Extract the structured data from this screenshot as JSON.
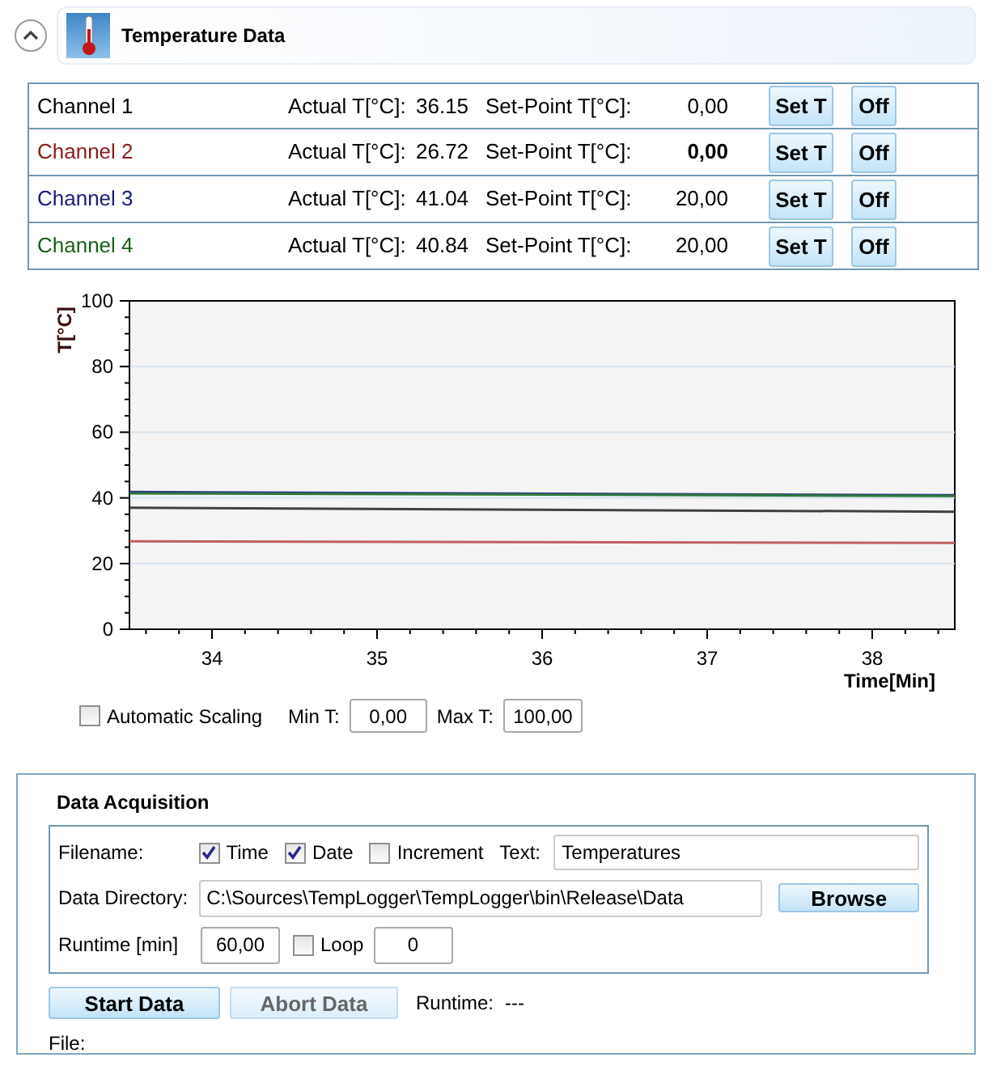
{
  "header": {
    "title": "Temperature Data",
    "expanded": true
  },
  "channels": [
    {
      "name": "Channel 1",
      "color": "#000000",
      "actual_label": "Actual T[°C]:",
      "actual": "36.15",
      "setpoint_label": "Set-Point T[°C]:",
      "setpoint": "0,00",
      "setpoint_bold": false,
      "set_button": "Set T",
      "off_button": "Off"
    },
    {
      "name": "Channel 2",
      "color": "#8b1a1a",
      "actual_label": "Actual T[°C]:",
      "actual": "26.72",
      "setpoint_label": "Set-Point T[°C]:",
      "setpoint": "0,00",
      "setpoint_bold": true,
      "set_button": "Set T",
      "off_button": "Off"
    },
    {
      "name": "Channel 3",
      "color": "#1a1a80",
      "actual_label": "Actual T[°C]:",
      "actual": "41.04",
      "setpoint_label": "Set-Point T[°C]:",
      "setpoint": "20,00",
      "setpoint_bold": false,
      "set_button": "Set T",
      "off_button": "Off"
    },
    {
      "name": "Channel 4",
      "color": "#1a5e1a",
      "actual_label": "Actual T[°C]:",
      "actual": "40.84",
      "setpoint_label": "Set-Point T[°C]:",
      "setpoint": "20,00",
      "setpoint_bold": false,
      "set_button": "Set T",
      "off_button": "Off"
    }
  ],
  "chart": {
    "chart_data": {
      "type": "line",
      "grid": true,
      "xlabel": "Time[Min]",
      "ylabel": "T[°C]",
      "x": [
        33.5,
        38.5
      ],
      "xlim": [
        33.5,
        38.5
      ],
      "ylim": [
        0,
        100
      ],
      "xticks": [
        34,
        35,
        36,
        37,
        38
      ],
      "yticks": [
        0,
        20,
        40,
        60,
        80,
        100
      ],
      "series": [
        {
          "color": "#404040",
          "values": [
            37.0,
            35.8
          ]
        },
        {
          "color": "#c06060",
          "values": [
            26.8,
            26.3
          ]
        },
        {
          "color": "#303090",
          "values": [
            41.8,
            40.8
          ]
        },
        {
          "color": "#2a7a3a",
          "values": [
            41.4,
            40.6
          ]
        }
      ]
    }
  },
  "scaling": {
    "auto_label": "Automatic Scaling",
    "auto_checked": false,
    "min_label": "Min T:",
    "min_value": "0,00",
    "max_label": "Max T:",
    "max_value": "100,00"
  },
  "acquisition": {
    "title": "Data Acquisition",
    "filename_label": "Filename:",
    "options": [
      {
        "label": "Time",
        "checked": true
      },
      {
        "label": "Date",
        "checked": true
      },
      {
        "label": "Increment",
        "checked": false
      }
    ],
    "text_label": "Text:",
    "text_value": "Temperatures",
    "directory_label": "Data Directory:",
    "directory_value": "C:\\Sources\\TempLogger\\TempLogger\\bin\\Release\\Data",
    "browse_button": "Browse",
    "runtime_label": "Runtime [min]",
    "runtime_value": "60,00",
    "loop_label": "Loop",
    "loop_checked": false,
    "loop_value": "0",
    "start_button": {
      "label": "Start Data",
      "disabled": false
    },
    "abort_button": {
      "label": "Abort Data",
      "disabled": true
    },
    "status_runtime_label": "Runtime:",
    "status_runtime_value": "---",
    "file_label": "File:"
  }
}
